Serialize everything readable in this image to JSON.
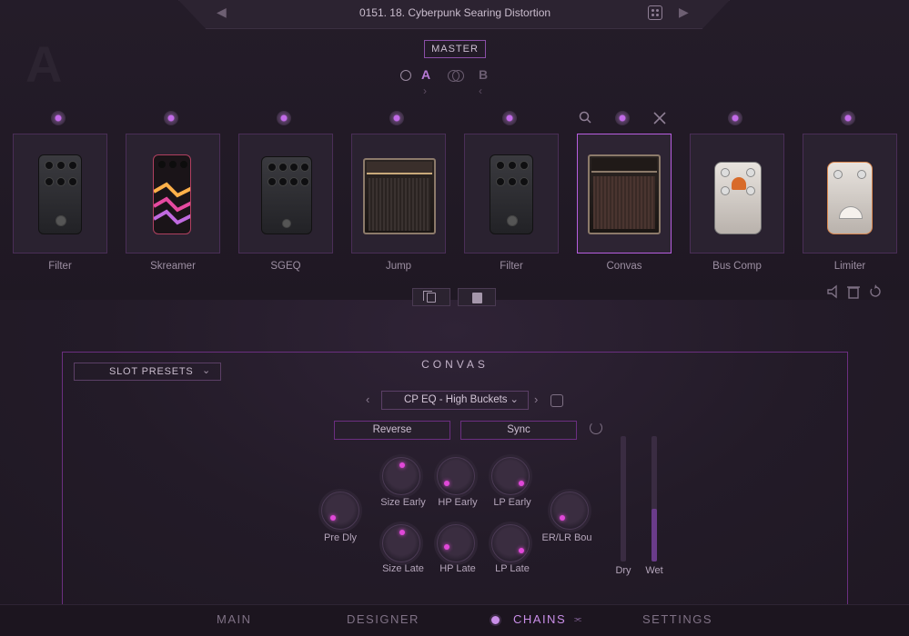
{
  "header": {
    "preset_name": "0151. 18. Cyberpunk Searing Distortion",
    "prev_arrow": "◀",
    "next_arrow": "▶",
    "big_letter": "A"
  },
  "routing": {
    "master_label": "MASTER",
    "a_label": "A",
    "b_label": "B"
  },
  "slots": [
    {
      "label": "Filter",
      "type": "pedal-dark"
    },
    {
      "label": "Skreamer",
      "type": "pedal-pattern"
    },
    {
      "label": "SGEQ",
      "type": "pedal-dark-wide"
    },
    {
      "label": "Jump",
      "type": "amp-head"
    },
    {
      "label": "Filter",
      "type": "pedal-dark"
    },
    {
      "label": "Convas",
      "type": "amp-combo",
      "selected": true
    },
    {
      "label": "Bus Comp",
      "type": "pedal-white"
    },
    {
      "label": "Limiter",
      "type": "pedal-white-orange"
    }
  ],
  "editor": {
    "slot_presets_label": "SLOT PRESETS",
    "title": "CONVAS",
    "preset_select": "CP EQ - High Buckets",
    "reverse_label": "Reverse",
    "sync_label": "Sync",
    "knobs": {
      "pre_dly": "Pre Dly",
      "size_early": "Size Early",
      "hp_early": "HP Early",
      "lp_early": "LP Early",
      "er_lr": "ER/LR Bou",
      "size_late": "Size Late",
      "hp_late": "HP Late",
      "lp_late": "LP Late"
    },
    "faders": {
      "dry_label": "Dry",
      "wet_label": "Wet",
      "dry_level": 0.0,
      "wet_level": 0.42
    }
  },
  "nav": {
    "main": "MAIN",
    "designer": "DESIGNER",
    "chains": "CHAINS",
    "settings": "SETTINGS",
    "active": "CHAINS"
  },
  "colors": {
    "accent": "#b75ee0",
    "knob_dot": "#e048d8",
    "background": "#221a26"
  }
}
